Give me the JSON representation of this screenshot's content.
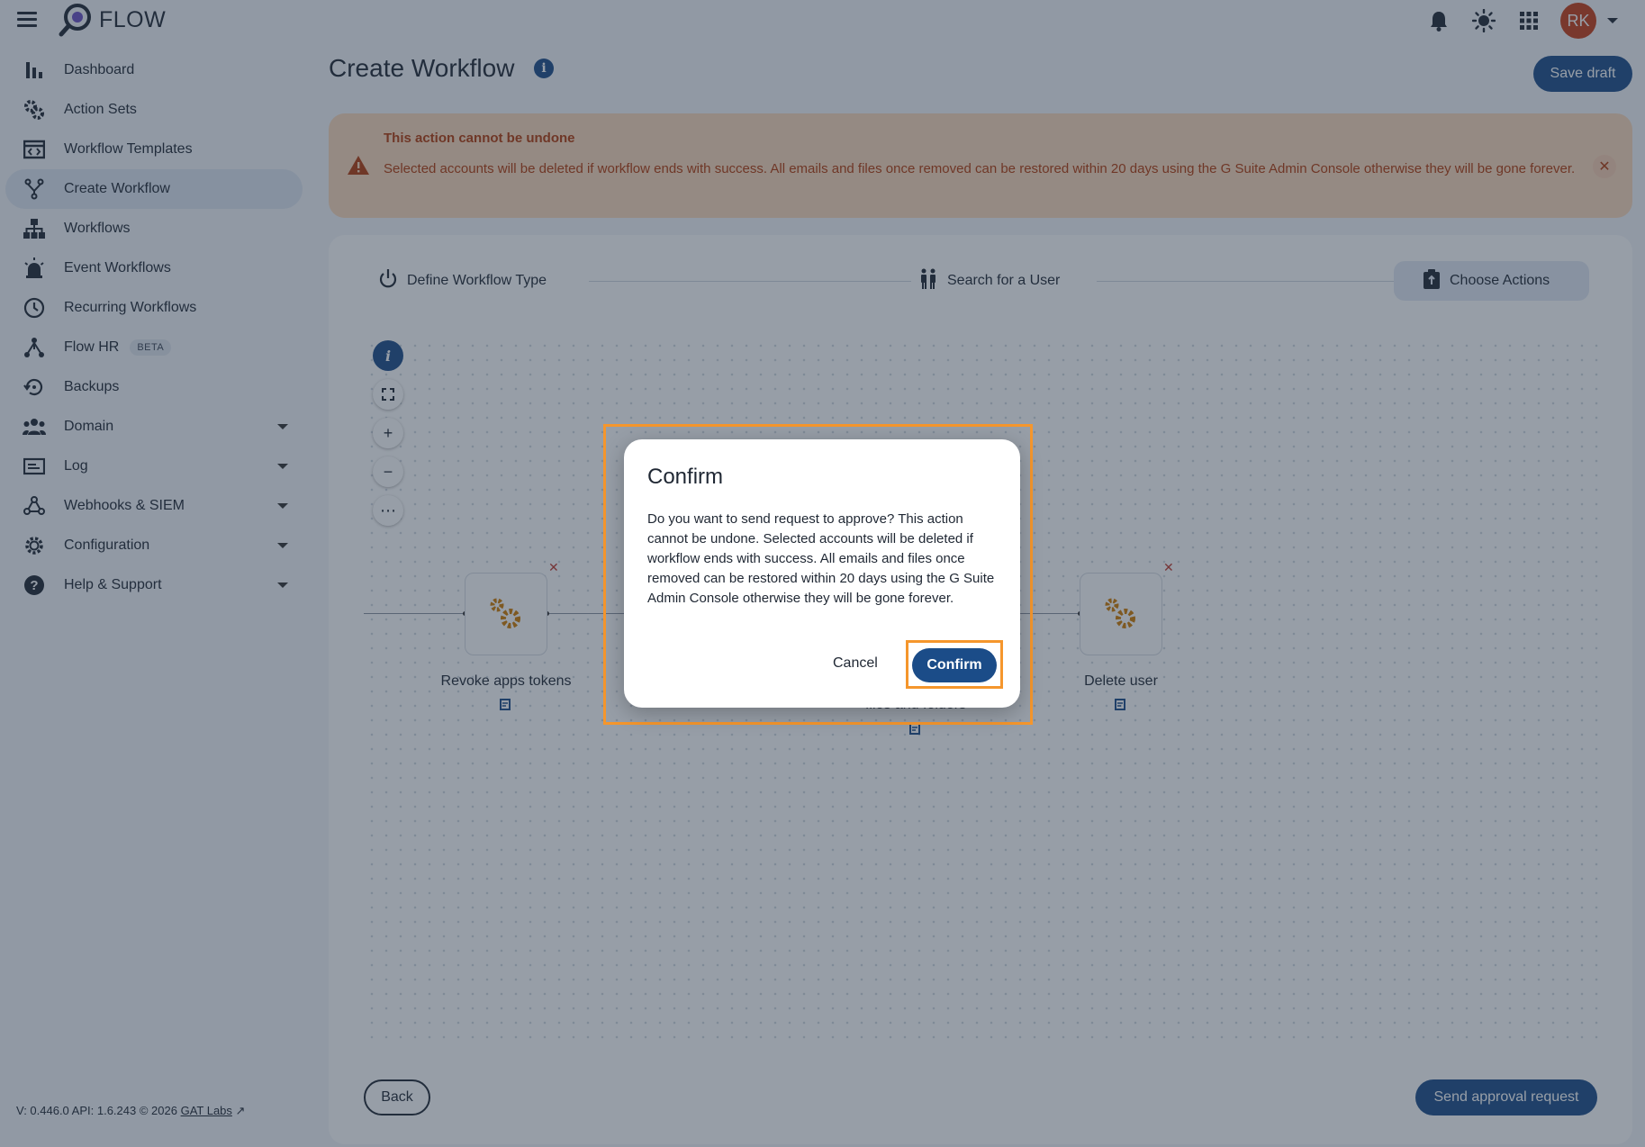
{
  "app": {
    "name": "FLOW"
  },
  "header": {
    "avatar_initials": "RK"
  },
  "sidebar": {
    "items": [
      {
        "label": "Dashboard"
      },
      {
        "label": "Action Sets"
      },
      {
        "label": "Workflow Templates"
      },
      {
        "label": "Create Workflow",
        "active": true
      },
      {
        "label": "Workflows"
      },
      {
        "label": "Event Workflows"
      },
      {
        "label": "Recurring Workflows"
      },
      {
        "label": "Flow HR",
        "badge": "BETA"
      },
      {
        "label": "Backups"
      },
      {
        "label": "Domain"
      },
      {
        "label": "Log"
      },
      {
        "label": "Webhooks & SIEM"
      },
      {
        "label": "Configuration"
      },
      {
        "label": "Help & Support"
      }
    ],
    "version": "V: 0.446.0   API: 1.6.243   © 2026",
    "company_link": "GAT Labs"
  },
  "page": {
    "title": "Create Workflow",
    "save_draft": "Save draft"
  },
  "alert": {
    "title": "This action cannot be undone",
    "text": "Selected accounts will be deleted if workflow ends with success. All emails and files once removed can be restored within 20 days using the G Suite Admin Console otherwise they will be gone forever."
  },
  "stepper": {
    "steps": [
      {
        "label": "Define Workflow Type"
      },
      {
        "label": "Search for a User"
      },
      {
        "label": "Choose Actions",
        "active": true
      }
    ]
  },
  "canvas": {
    "nodes": [
      {
        "label": "Revoke apps tokens"
      },
      {
        "label": "files and folders"
      },
      {
        "label": "Delete user"
      }
    ]
  },
  "footer": {
    "back": "Back",
    "send": "Send approval request"
  },
  "dialog": {
    "title": "Confirm",
    "text": "Do you want to send request to approve? This action cannot be undone. Selected accounts will be deleted if workflow ends with success. All emails and files once removed can be restored within 20 days using the G Suite Admin Console otherwise they will be gone forever.",
    "cancel": "Cancel",
    "confirm": "Confirm"
  },
  "colors": {
    "primary": "#1b4c88",
    "alert_bg": "#fcd8ba",
    "alert_text": "#b23b0a",
    "highlight": "#f5962c",
    "avatar": "#c63c16"
  }
}
